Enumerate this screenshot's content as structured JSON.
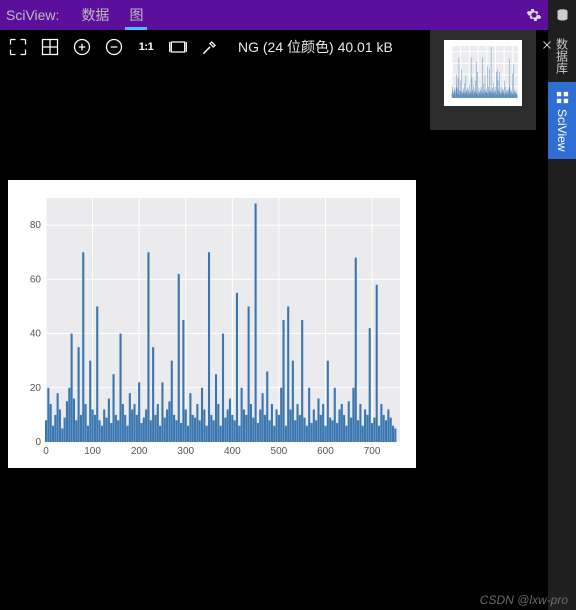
{
  "header": {
    "title": "SciView:",
    "tabs": [
      {
        "label": "数据",
        "active": false
      },
      {
        "label": "图",
        "active": true
      }
    ]
  },
  "toolbar": {
    "meta_text": "NG (24 位颜色) 40.01 kB",
    "one_to_one": "1:1"
  },
  "thumbnail": {
    "close_label": "close"
  },
  "right_rail": {
    "items": [
      {
        "label": "数据库",
        "key": "database"
      },
      {
        "label": "SciView",
        "key": "sciview"
      }
    ]
  },
  "watermark": "CSDN @lxw-pro",
  "chart_data": {
    "type": "bar",
    "xlabel": "",
    "ylabel": "",
    "xlim": [
      0,
      760
    ],
    "ylim": [
      0,
      90
    ],
    "xticks": [
      0,
      100,
      200,
      300,
      400,
      500,
      600,
      700
    ],
    "yticks": [
      0,
      20,
      40,
      60,
      80
    ],
    "x": [
      0,
      5,
      10,
      15,
      20,
      25,
      30,
      35,
      40,
      45,
      50,
      55,
      60,
      65,
      70,
      75,
      80,
      85,
      90,
      95,
      100,
      105,
      110,
      115,
      120,
      125,
      130,
      135,
      140,
      145,
      150,
      155,
      160,
      165,
      170,
      175,
      180,
      185,
      190,
      195,
      200,
      205,
      210,
      215,
      220,
      225,
      230,
      235,
      240,
      245,
      250,
      255,
      260,
      265,
      270,
      275,
      280,
      285,
      290,
      295,
      300,
      305,
      310,
      315,
      320,
      325,
      330,
      335,
      340,
      345,
      350,
      355,
      360,
      365,
      370,
      375,
      380,
      385,
      390,
      395,
      400,
      405,
      410,
      415,
      420,
      425,
      430,
      435,
      440,
      445,
      450,
      455,
      460,
      465,
      470,
      475,
      480,
      485,
      490,
      495,
      500,
      505,
      510,
      515,
      520,
      525,
      530,
      535,
      540,
      545,
      550,
      555,
      560,
      565,
      570,
      575,
      580,
      585,
      590,
      595,
      600,
      605,
      610,
      615,
      620,
      625,
      630,
      635,
      640,
      645,
      650,
      655,
      660,
      665,
      670,
      675,
      680,
      685,
      690,
      695,
      700,
      705,
      710,
      715,
      720,
      725,
      730,
      735,
      740,
      745,
      750
    ],
    "values": [
      8,
      20,
      14,
      6,
      10,
      18,
      12,
      5,
      9,
      15,
      20,
      40,
      16,
      8,
      35,
      10,
      70,
      14,
      6,
      30,
      12,
      10,
      50,
      8,
      6,
      12,
      9,
      16,
      7,
      25,
      10,
      8,
      40,
      14,
      10,
      6,
      18,
      12,
      14,
      10,
      22,
      7,
      9,
      12,
      70,
      8,
      35,
      10,
      14,
      6,
      22,
      9,
      12,
      15,
      30,
      10,
      8,
      62,
      7,
      45,
      12,
      6,
      18,
      10,
      9,
      14,
      8,
      20,
      12,
      6,
      70,
      10,
      8,
      25,
      14,
      6,
      40,
      9,
      12,
      16,
      10,
      8,
      55,
      6,
      20,
      12,
      10,
      50,
      14,
      9,
      88,
      7,
      12,
      18,
      10,
      26,
      8,
      14,
      6,
      12,
      10,
      20,
      45,
      6,
      50,
      12,
      30,
      8,
      14,
      10,
      45,
      9,
      6,
      20,
      7,
      12,
      8,
      16,
      10,
      14,
      6,
      30,
      9,
      8,
      20,
      7,
      12,
      14,
      10,
      6,
      15,
      9,
      20,
      68,
      8,
      14,
      6,
      12,
      10,
      42,
      7,
      9,
      58,
      6,
      14,
      10,
      8,
      12,
      9,
      6,
      5
    ]
  }
}
